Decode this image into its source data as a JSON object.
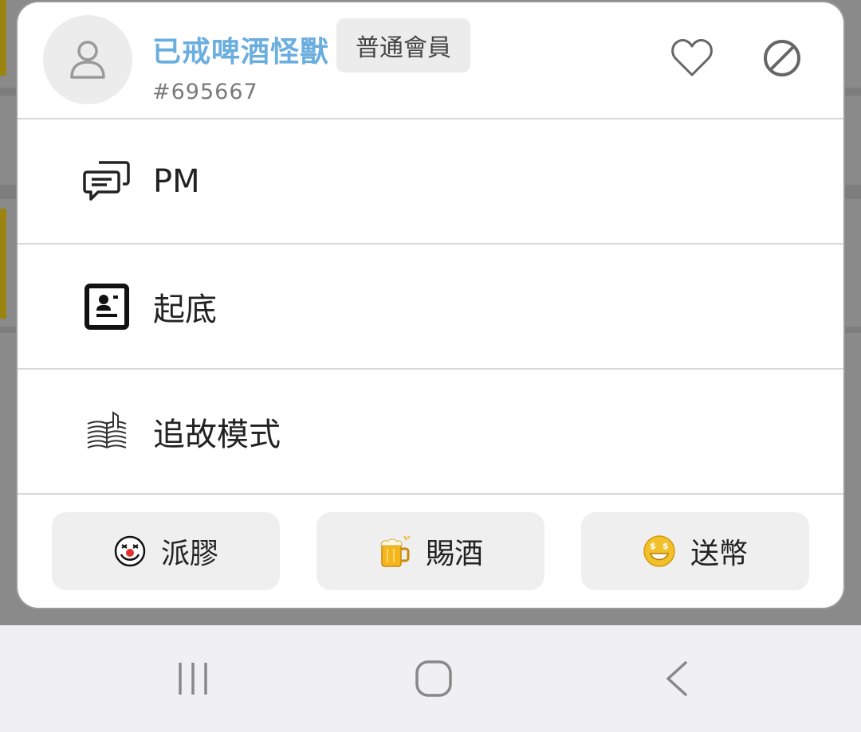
{
  "profile": {
    "username": "已戒啤酒怪獸",
    "member_level": "普通會員",
    "user_id": "#695667"
  },
  "menu": [
    {
      "label": "PM",
      "icon": "chat-bubbles-icon"
    },
    {
      "label": "起底",
      "icon": "profile-card-icon"
    },
    {
      "label": "追故模式",
      "icon": "open-book-icon"
    }
  ],
  "actions": [
    {
      "label": "派膠",
      "icon": "clown-face-icon"
    },
    {
      "label": "賜酒",
      "icon": "beer-mug-icon"
    },
    {
      "label": "送幣",
      "icon": "money-face-icon"
    }
  ],
  "navigation": [
    "recent-apps-icon",
    "home-icon",
    "back-icon"
  ],
  "colors": {
    "username": "#6aaedf",
    "badge_bg": "#ececec",
    "action_bg": "#efefef",
    "navbar_bg": "#f0f0f2"
  }
}
